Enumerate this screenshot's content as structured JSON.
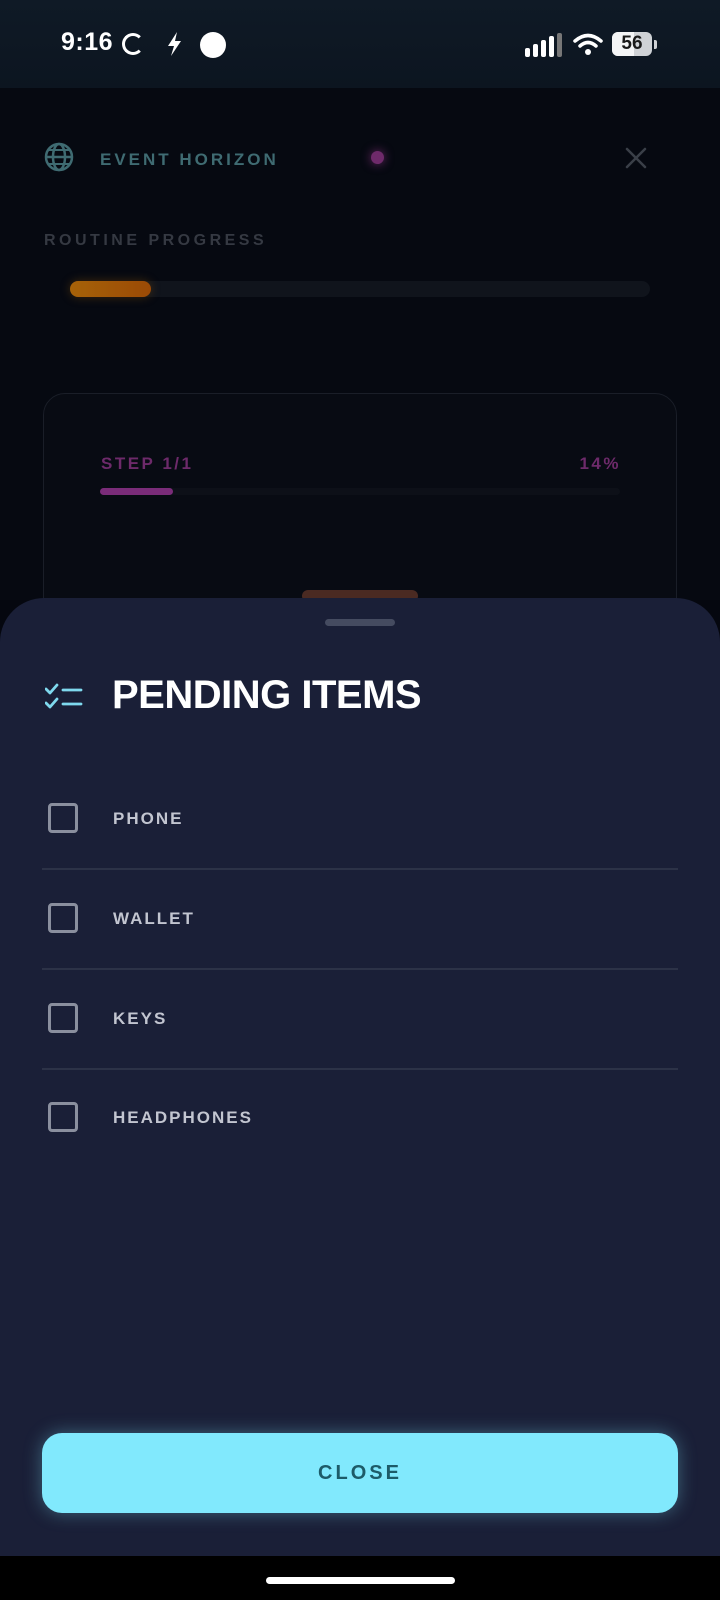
{
  "status_bar": {
    "time": "9:16",
    "battery": "56"
  },
  "background_screen": {
    "app_title": "EVENT HORIZON",
    "progress_label": "ROUTINE PROGRESS",
    "routine_progress": 0.14,
    "step_label": "STEP 1/1",
    "step_percent_text": "14%",
    "step_progress": 0.14
  },
  "sheet": {
    "title": "PENDING ITEMS",
    "items": [
      {
        "label": "PHONE",
        "checked": false
      },
      {
        "label": "WALLET",
        "checked": false
      },
      {
        "label": "KEYS",
        "checked": false
      },
      {
        "label": "HEADPHONES",
        "checked": false
      }
    ],
    "close_label": "CLOSE"
  },
  "colors": {
    "sheet_bg": "#1a1f37",
    "accent_cyan": "#81e9fd",
    "accent_pink": "#7a2c79",
    "accent_orange": "#a66208"
  },
  "icons": [
    "globe-icon",
    "close-icon",
    "checklist-icon",
    "checkbox-icon",
    "wifi-icon",
    "signal-icon",
    "battery-icon",
    "bolt-icon"
  ]
}
